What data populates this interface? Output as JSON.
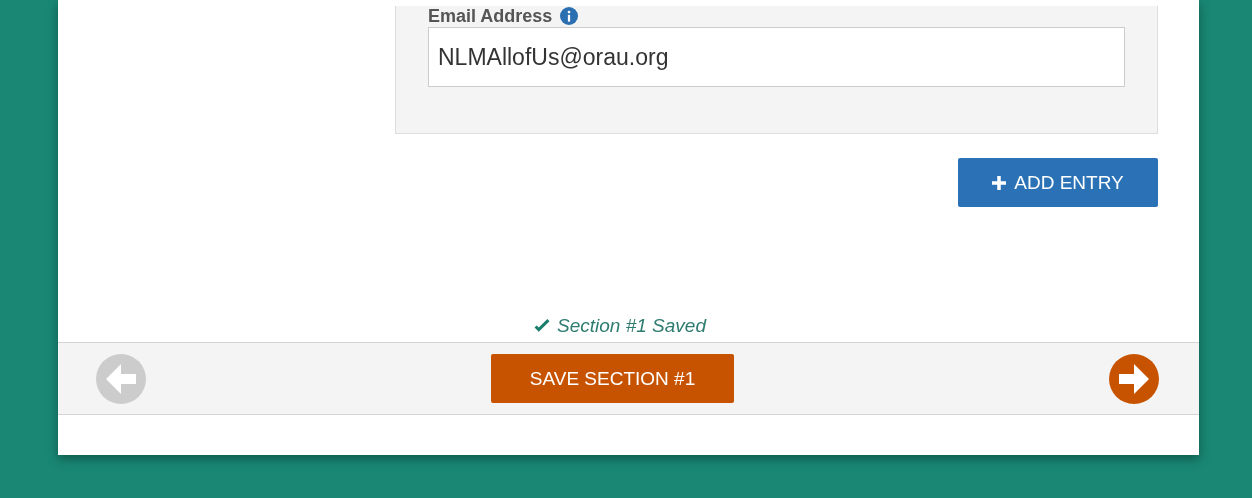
{
  "entry": {
    "field_label": "Email Address",
    "value": "NLMAllofUs@orau.org"
  },
  "add_button": "ADD ENTRY",
  "save_status": "Section #1 Saved",
  "footer": {
    "previous": {
      "disabled": true
    },
    "save_button": "SAVE SECTION #1",
    "next": {
      "disabled": false
    }
  }
}
